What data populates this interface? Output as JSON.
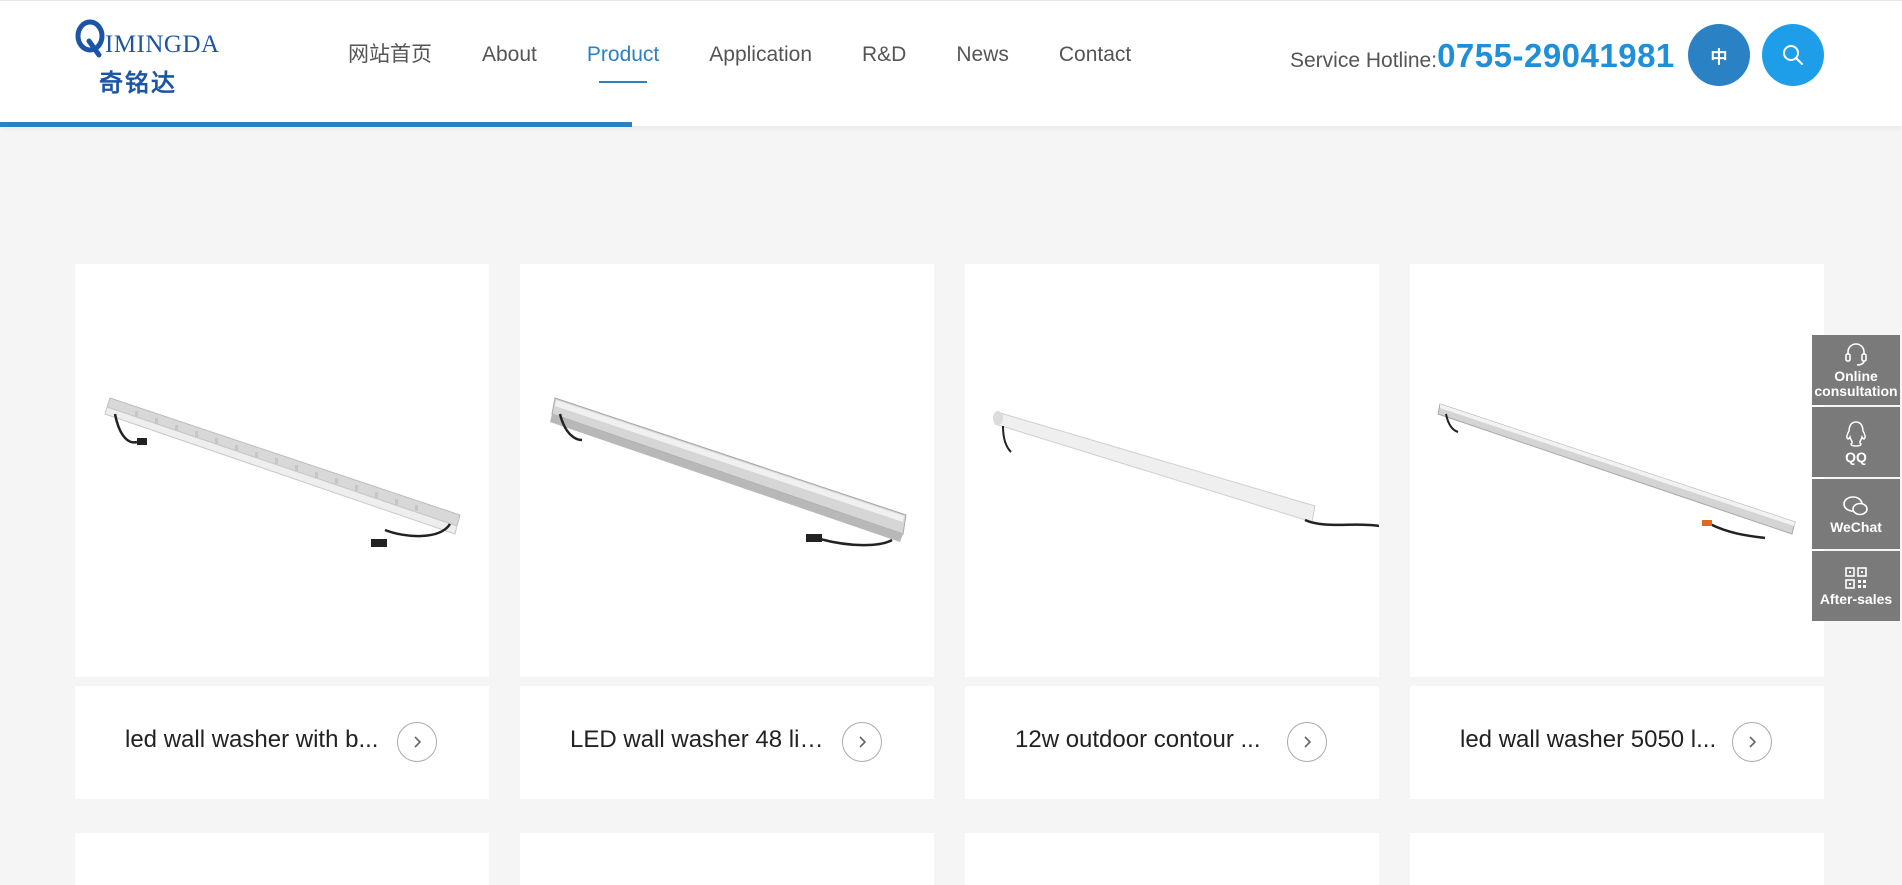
{
  "header": {
    "logo_en": "IMINGDA",
    "logo_cn": "奇铭达",
    "nav": [
      {
        "label": "网站首页",
        "active": false
      },
      {
        "label": "About",
        "active": false
      },
      {
        "label": "Product",
        "active": true
      },
      {
        "label": "Application",
        "active": false
      },
      {
        "label": "R&D",
        "active": false
      },
      {
        "label": "News",
        "active": false
      },
      {
        "label": "Contact",
        "active": false
      }
    ],
    "hotline_label": "Service Hotline:",
    "hotline_number": "0755-29041981",
    "lang_label": "中",
    "search_icon": "search-icon"
  },
  "colors": {
    "accent": "#2a82c4",
    "hotline": "#1e8fd8",
    "search": "#1e9ee8",
    "sidebar": "#7a7a7a"
  },
  "products": [
    {
      "title": "led wall washer with b..."
    },
    {
      "title": "LED wall washer 48 lig..."
    },
    {
      "title": "12w outdoor contour ..."
    },
    {
      "title": "led wall washer 5050 l..."
    }
  ],
  "sidebar": [
    {
      "label": "Online consultation",
      "icon": "headset-icon"
    },
    {
      "label": "QQ",
      "icon": "qq-icon"
    },
    {
      "label": "WeChat",
      "icon": "wechat-icon"
    },
    {
      "label": "After-sales",
      "icon": "qrcode-icon"
    }
  ]
}
